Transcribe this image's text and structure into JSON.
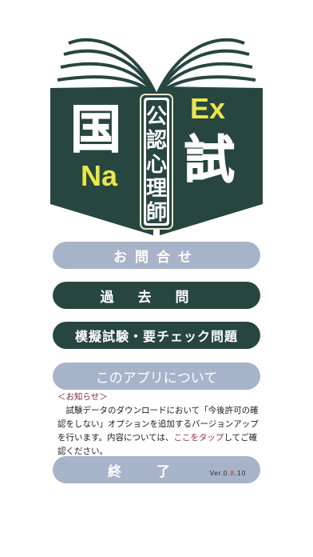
{
  "logo": {
    "kanji_left": "国",
    "kanji_right": "試",
    "na": "Na",
    "ex": "Ex",
    "spine_text": [
      "公",
      "認",
      "心",
      "理",
      "師"
    ],
    "colors": {
      "book": "#27463f",
      "accent": "#e9e64a",
      "cream": "#e9e4c8"
    }
  },
  "buttons": {
    "inquiry": "お問合せ",
    "past_exams": "過去問",
    "mock_exam": "模擬試験・要チェック問題",
    "about": "このアプリについて",
    "exit": "終了"
  },
  "notice": {
    "title": "＜お知らせ＞",
    "body_1": "試験データのダウンロードにおいて「今後許可の確認をしない」オプションを追加するバージョンアップを行います。内容については、",
    "link": "ここをタップ",
    "body_2": "してご確認ください。"
  },
  "version": {
    "prefix": "Ver.0.",
    "mid": "8",
    "suffix": ".10"
  },
  "colors": {
    "primary_dark": "#27463f",
    "button_light": "#a7b3c8",
    "link": "#a03048"
  }
}
